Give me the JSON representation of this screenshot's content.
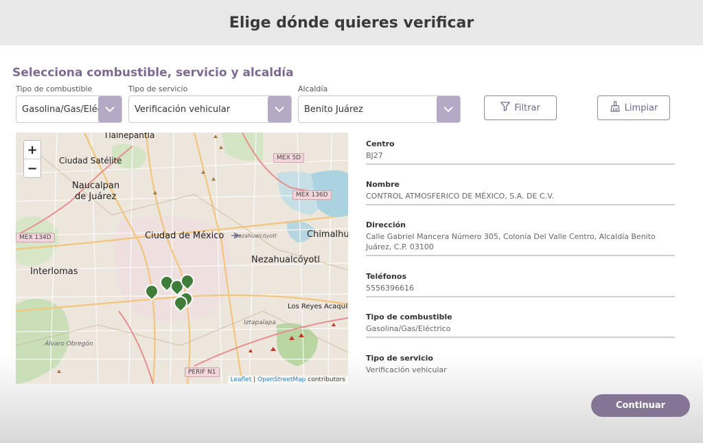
{
  "header": {
    "title": "Elige dónde quieres verificar"
  },
  "section": {
    "title": "Selecciona combustible, servicio y alcaldía"
  },
  "filters": {
    "fuel": {
      "label": "Tipo de combustible",
      "value": "Gasolina/Gas/Eléctrico"
    },
    "service": {
      "label": "Tipo de servicio",
      "value": "Verificación vehicular"
    },
    "borough": {
      "label": "Alcaldía",
      "value": "Benito Juárez"
    },
    "filter_button": "Filtrar",
    "clear_button": "Limpiar"
  },
  "map": {
    "zoom_in": "+",
    "zoom_out": "−",
    "places": {
      "tlalnepantla": "Tlalnepantla",
      "ciudad_satelite": "Ciudad Satélite",
      "naucalpan": "Naucalpan",
      "de_juarez": "de Juárez",
      "ciudad_mexico": "Ciudad de México",
      "chimalhuacan": "Chimalhua",
      "nezahualcoyotl": "Nezahualcóyotl",
      "interlomas": "Interlomas",
      "los_reyes": "Los Reyes Acaquilpa",
      "alvaro_obregon": "Álvaro Obregón",
      "iztapalapa": "Iztapalapa",
      "nezahualcoyotl_small": "Nezahualcóyotl"
    },
    "roads": {
      "mex5d": "MEX 5D",
      "mex136d": "MEX 136D",
      "mex134d": "MEX 134D",
      "perif": "PERIF N1"
    },
    "attribution": {
      "leaflet": "Leaflet",
      "sep": " | ",
      "osm": "OpenStreetMap",
      "rest": " contributors"
    }
  },
  "info": {
    "centro": {
      "label": "Centro",
      "value": "BJ27"
    },
    "nombre": {
      "label": "Nombre",
      "value": "CONTROL ATMOSFERICO DE MÉXICO, S.A. DE C.V."
    },
    "direccion": {
      "label": "Dirección",
      "value": "Calle Gabriel Mancera Número 305, Colonia Del Valle Centro, Alcaldía Benito Juárez, C.P. 03100"
    },
    "telefonos": {
      "label": "Teléfonos",
      "value": "5556396616"
    },
    "combustible": {
      "label": "Tipo de combustible",
      "value": "Gasolina/Gas/Eléctrico"
    },
    "servicio": {
      "label": "Tipo de servicio",
      "value": "Verificación vehicular"
    }
  },
  "actions": {
    "continue": "Continuar"
  },
  "colors": {
    "accent": "#857595",
    "title": "#7b6a91",
    "marker": "#3f7d3a"
  }
}
